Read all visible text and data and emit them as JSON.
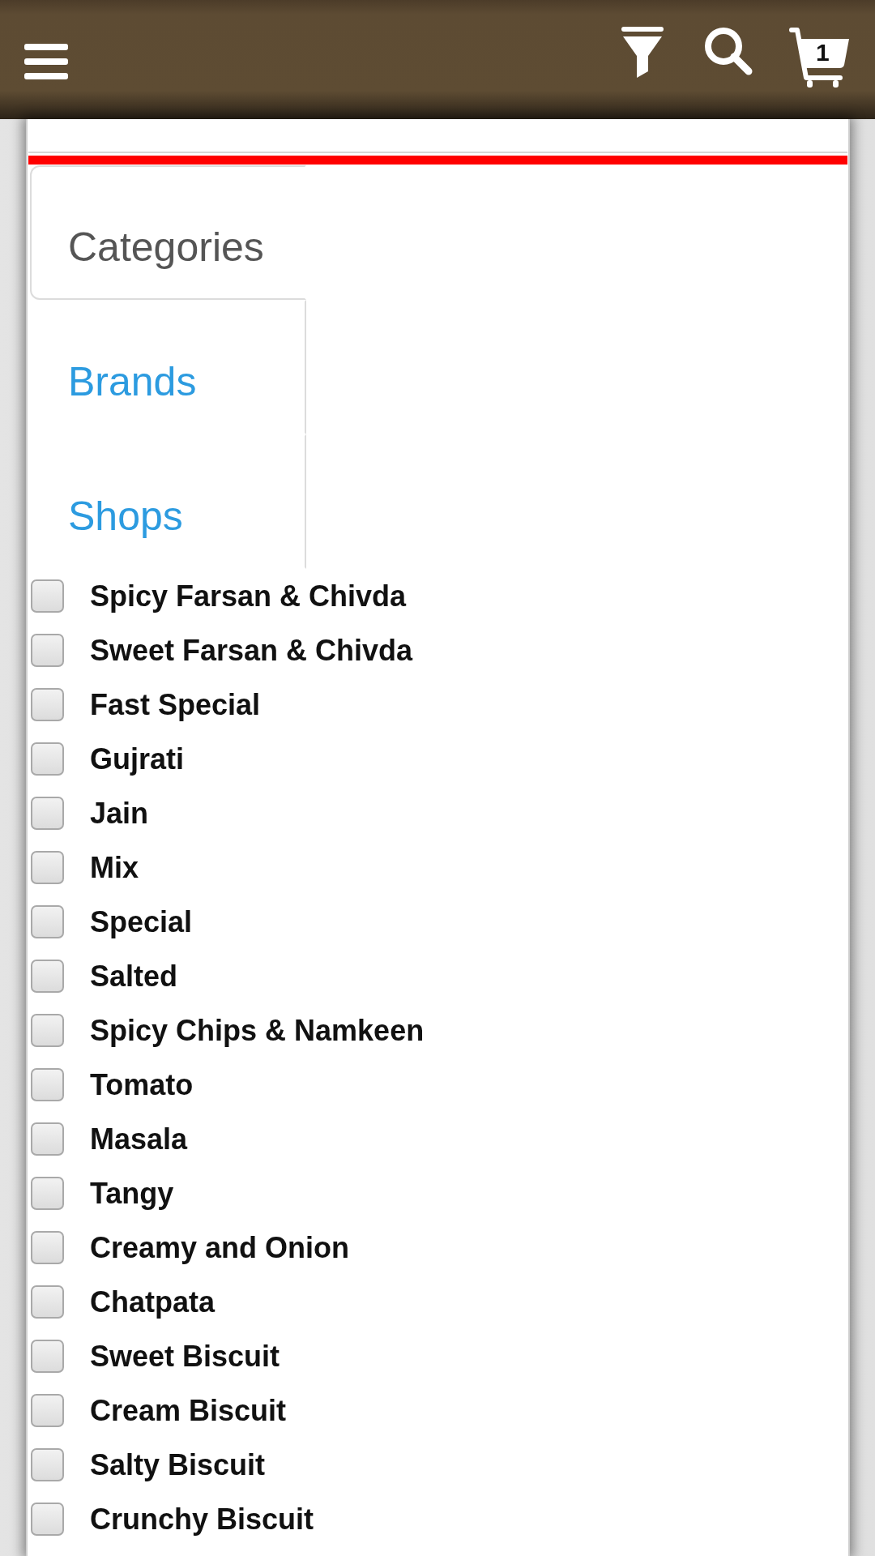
{
  "header": {
    "cart_count": "1"
  },
  "filter_tabs": [
    {
      "label": "Categories",
      "selected": true
    },
    {
      "label": "Brands",
      "selected": false
    },
    {
      "label": "Shops",
      "selected": false
    }
  ],
  "options": [
    {
      "label": "Spicy Farsan & Chivda",
      "checked": false
    },
    {
      "label": "Sweet Farsan & Chivda",
      "checked": false
    },
    {
      "label": "Fast Special",
      "checked": false
    },
    {
      "label": "Gujrati",
      "checked": false
    },
    {
      "label": "Jain",
      "checked": false
    },
    {
      "label": "Mix",
      "checked": false
    },
    {
      "label": "Special",
      "checked": false
    },
    {
      "label": "Salted",
      "checked": false
    },
    {
      "label": "Spicy Chips & Namkeen",
      "checked": false
    },
    {
      "label": "Tomato",
      "checked": false
    },
    {
      "label": "Masala",
      "checked": false
    },
    {
      "label": "Tangy",
      "checked": false
    },
    {
      "label": "Creamy and Onion",
      "checked": false
    },
    {
      "label": "Chatpata",
      "checked": false
    },
    {
      "label": "Sweet Biscuit",
      "checked": false
    },
    {
      "label": "Cream Biscuit",
      "checked": false
    },
    {
      "label": "Salty Biscuit",
      "checked": false
    },
    {
      "label": "Crunchy Biscuit",
      "checked": false
    }
  ]
}
